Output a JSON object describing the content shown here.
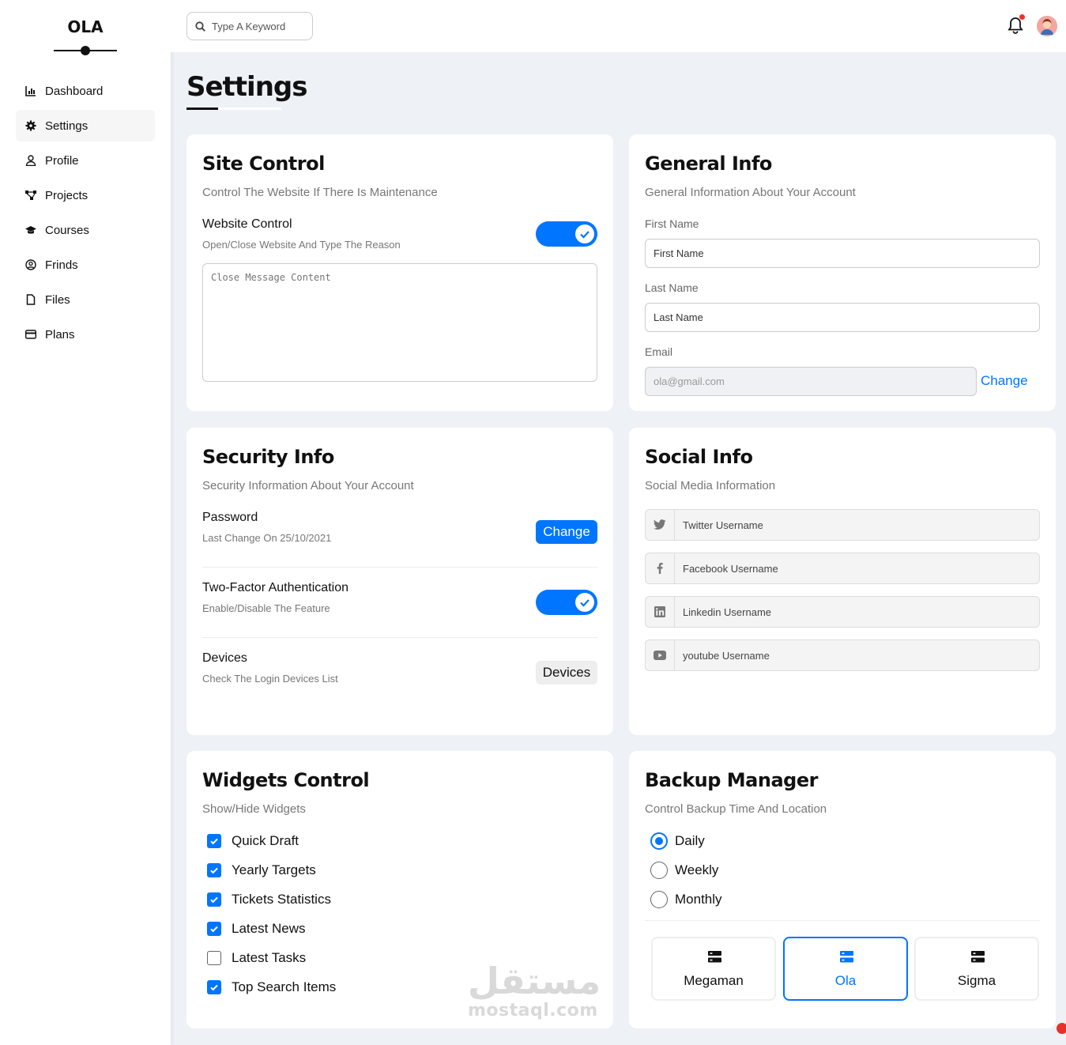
{
  "brand": {
    "name": "OLA"
  },
  "sidebar": {
    "items": [
      {
        "label": "Dashboard",
        "icon": "chart-icon",
        "active": false
      },
      {
        "label": "Settings",
        "icon": "gear-icon",
        "active": true
      },
      {
        "label": "Profile",
        "icon": "user-icon",
        "active": false
      },
      {
        "label": "Projects",
        "icon": "diagram-icon",
        "active": false
      },
      {
        "label": "Courses",
        "icon": "graduation-cap-icon",
        "active": false
      },
      {
        "label": "Frinds",
        "icon": "user-circle-icon",
        "active": false
      },
      {
        "label": "Files",
        "icon": "file-icon",
        "active": false
      },
      {
        "label": "Plans",
        "icon": "credit-card-icon",
        "active": false
      }
    ]
  },
  "header": {
    "search_placeholder": "Type A Keyword",
    "notification_badge": true
  },
  "page": {
    "title": "Settings"
  },
  "site_control": {
    "title": "Site Control",
    "subtitle": "Control The Website If There Is Maintenance",
    "website_control_label": "Website Control",
    "website_control_desc": "Open/Close Website And Type The Reason",
    "website_control_on": true,
    "message_placeholder": "Close Message Content"
  },
  "general_info": {
    "title": "General Info",
    "subtitle": "General Information About Your Account",
    "first_name_label": "First Name",
    "first_name_placeholder": "First Name",
    "last_name_label": "Last Name",
    "last_name_placeholder": "Last Name",
    "email_label": "Email",
    "email_value": "ola@gmail.com",
    "change_link": "Change"
  },
  "security_info": {
    "title": "Security Info",
    "subtitle": "Security Information About Your Account",
    "password_label": "Password",
    "password_desc": "Last Change On 25/10/2021",
    "password_button": "Change",
    "twofa_label": "Two-Factor Authentication",
    "twofa_desc": "Enable/Disable The Feature",
    "twofa_on": true,
    "devices_label": "Devices",
    "devices_desc": "Check The Login Devices List",
    "devices_button": "Devices"
  },
  "social_info": {
    "title": "Social Info",
    "subtitle": "Social Media Information",
    "fields": [
      {
        "icon": "twitter-icon",
        "placeholder": "Twitter Username"
      },
      {
        "icon": "facebook-icon",
        "placeholder": "Facebook Username"
      },
      {
        "icon": "linkedin-icon",
        "placeholder": "Linkedin Username"
      },
      {
        "icon": "youtube-icon",
        "placeholder": "youtube Username"
      }
    ]
  },
  "widgets_control": {
    "title": "Widgets Control",
    "subtitle": "Show/Hide Widgets",
    "items": [
      {
        "label": "Quick Draft",
        "checked": true
      },
      {
        "label": "Yearly Targets",
        "checked": true
      },
      {
        "label": "Tickets Statistics",
        "checked": true
      },
      {
        "label": "Latest News",
        "checked": true
      },
      {
        "label": "Latest Tasks",
        "checked": false
      },
      {
        "label": "Top Search Items",
        "checked": true
      }
    ]
  },
  "backup_manager": {
    "title": "Backup Manager",
    "subtitle": "Control Backup Time And Location",
    "options": [
      {
        "label": "Daily",
        "selected": true
      },
      {
        "label": "Weekly",
        "selected": false
      },
      {
        "label": "Monthly",
        "selected": false
      }
    ],
    "servers": [
      {
        "label": "Megaman",
        "selected": false
      },
      {
        "label": "Ola",
        "selected": true
      },
      {
        "label": "Sigma",
        "selected": false
      }
    ]
  },
  "watermark": {
    "arabic": "مستقل",
    "latin": "mostaql.com"
  },
  "colors": {
    "accent": "#0075ff",
    "background": "#eef1f5",
    "badge": "#f42e2e"
  }
}
